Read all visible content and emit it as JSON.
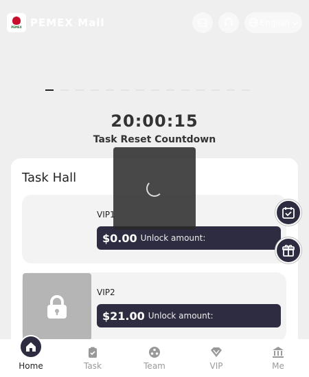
{
  "header": {
    "app_title": "PEMEX Mall",
    "logo_text": "PEMEX",
    "language": "English"
  },
  "countdown": {
    "time": "20:00:15",
    "label": "Task Reset Countdown"
  },
  "task_hall": {
    "title": "Task Hall",
    "items": [
      {
        "name": "VIP1",
        "amount": "$0.00",
        "unlock_label": "Unlock amount:",
        "locked": false
      },
      {
        "name": "VIP2",
        "amount": "$21.00",
        "unlock_label": "Unlock amount:",
        "locked": true
      }
    ]
  },
  "tabs": [
    {
      "label": "Home",
      "icon": "home-icon",
      "active": true
    },
    {
      "label": "Task",
      "icon": "clipboard-check-icon",
      "active": false
    },
    {
      "label": "Team",
      "icon": "team-icon",
      "active": false
    },
    {
      "label": "VIP",
      "icon": "diamond-icon",
      "active": false
    },
    {
      "label": "Me",
      "icon": "bank-icon",
      "active": false
    }
  ],
  "colors": {
    "accent_dark": "#2e2c40",
    "background": "#efefef"
  }
}
